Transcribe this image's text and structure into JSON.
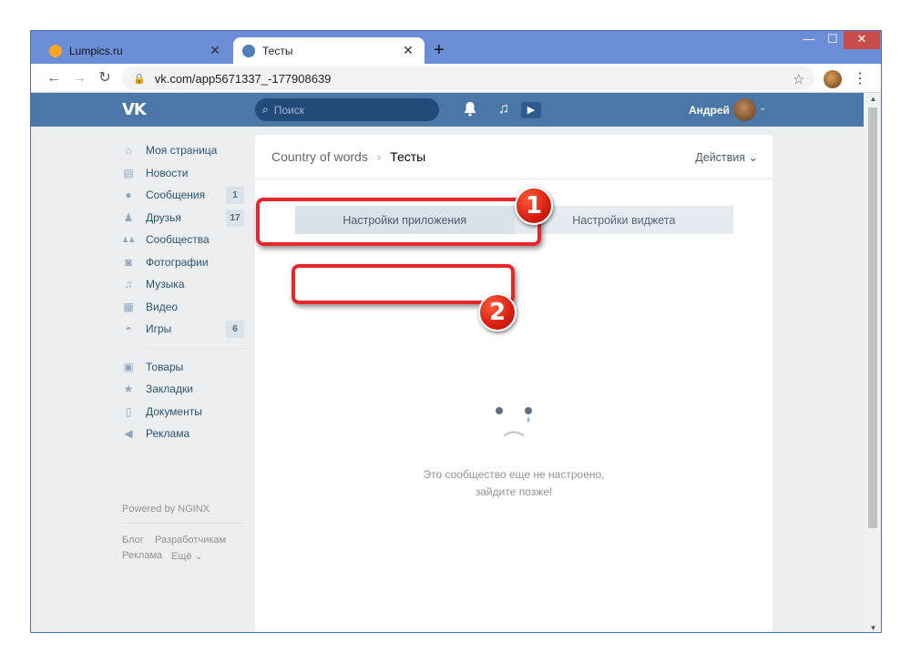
{
  "browser": {
    "tabs": [
      {
        "title": "Lumpics.ru",
        "close": "✕",
        "favicon_color": "#f5a623"
      },
      {
        "title": "Тесты",
        "close": "✕",
        "favicon_color": "#5181b8"
      }
    ],
    "new_tab": "+",
    "window_controls": {
      "minimize": "—",
      "maximize": "☐",
      "close": "✕"
    },
    "nav": {
      "back": "←",
      "forward": "→",
      "reload": "↻"
    },
    "address": "vk.com/app5671337_-177908639",
    "lock": "🔒",
    "star": "☆",
    "menu": "⋮"
  },
  "vk_header": {
    "logo": "VK",
    "search_placeholder": "Поиск",
    "search_icon": "⌕",
    "bell": "🔔",
    "music": "♫",
    "play": "▶",
    "user_name": "Андрей",
    "caret": "⌄",
    "colors": {
      "header": "#4a76a8",
      "search": "#224b7a"
    }
  },
  "sidebar": {
    "items": [
      {
        "label": "Моя страница",
        "icon": "home-icon",
        "glyph": "⌂",
        "badge": ""
      },
      {
        "label": "Новости",
        "icon": "news-icon",
        "glyph": "▤",
        "badge": ""
      },
      {
        "label": "Сообщения",
        "icon": "messages-icon",
        "glyph": "●",
        "badge": "1"
      },
      {
        "label": "Друзья",
        "icon": "friends-icon",
        "glyph": "♟",
        "badge": "17"
      },
      {
        "label": "Сообщества",
        "icon": "communities-icon",
        "glyph": "♟♟",
        "badge": ""
      },
      {
        "label": "Фотографии",
        "icon": "camera-icon",
        "glyph": "◙",
        "badge": ""
      },
      {
        "label": "Музыка",
        "icon": "music-icon",
        "glyph": "♫",
        "badge": ""
      },
      {
        "label": "Видео",
        "icon": "video-icon",
        "glyph": "▦",
        "badge": ""
      },
      {
        "label": "Игры",
        "icon": "gamepad-icon",
        "glyph": "◓",
        "badge": "6"
      }
    ],
    "items2": [
      {
        "label": "Товары",
        "icon": "bag-icon",
        "glyph": "▣"
      },
      {
        "label": "Закладки",
        "icon": "star-icon",
        "glyph": "★"
      },
      {
        "label": "Документы",
        "icon": "document-icon",
        "glyph": "▯"
      },
      {
        "label": "Реклама",
        "icon": "megaphone-icon",
        "glyph": "◀"
      }
    ],
    "powered": "Powered by NGINX",
    "footer": {
      "blog": "Блог",
      "developers": "Разработчикам",
      "ads": "Реклама",
      "more": "Ещё ⌄"
    }
  },
  "main": {
    "breadcrumb": {
      "app": "Country of words",
      "separator": "›",
      "current": "Тесты"
    },
    "actions": "Действия ⌄",
    "tabs": [
      {
        "label": "Настройки приложения",
        "active": true
      },
      {
        "label": "Настройки виджета",
        "active": false
      }
    ],
    "empty_line1": "Это сообщество еще не настроено,",
    "empty_line2": "зайдите позже!"
  },
  "annotations": {
    "marker1": "1",
    "marker2": "2",
    "color": "#e6262a"
  },
  "scrollbar": {
    "up": "▲",
    "down": "▼"
  }
}
